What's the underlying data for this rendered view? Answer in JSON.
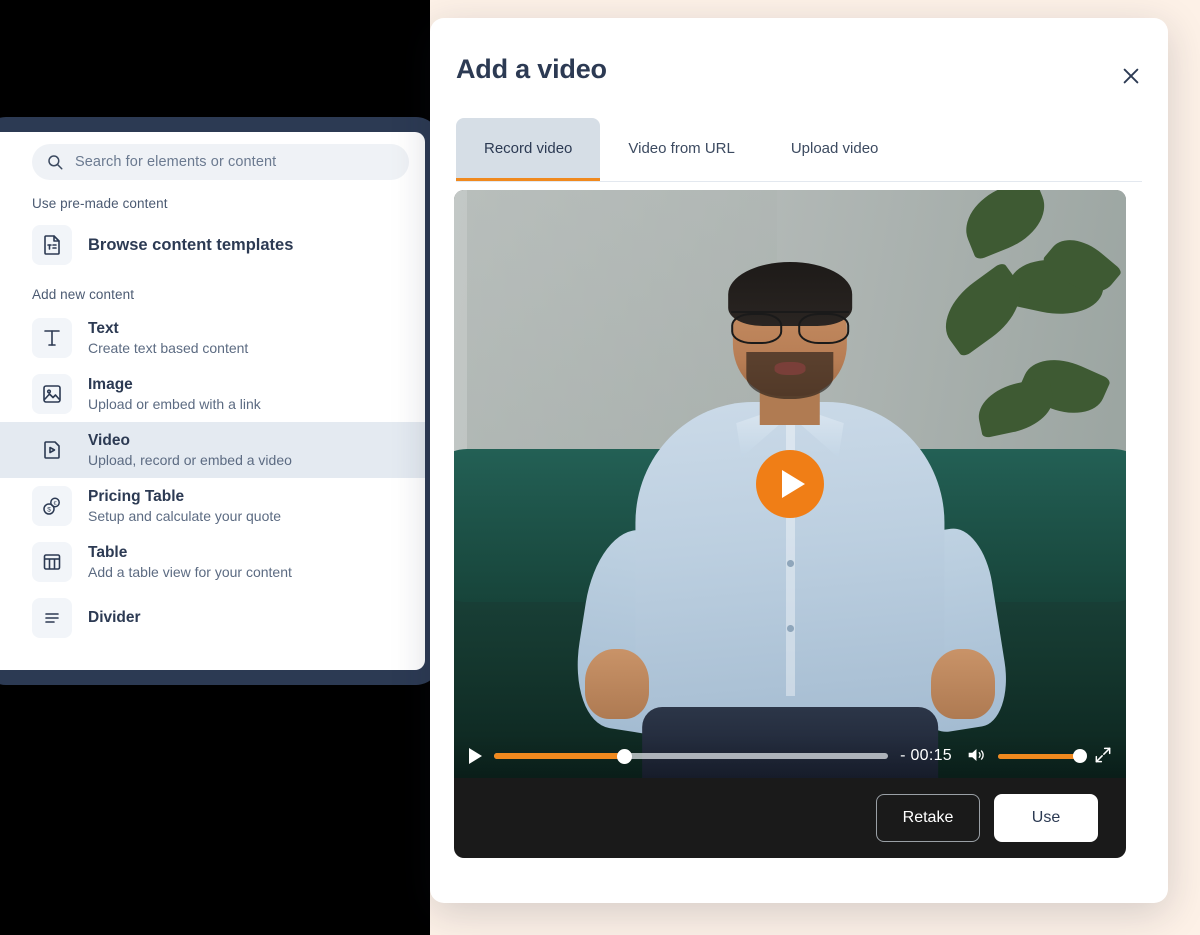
{
  "theme": {
    "page_background": "#FDF1E7",
    "accent_orange": "#F0891E",
    "navy": "#2C3A53",
    "active_tab_bg": "#D6DEE6",
    "panel_dark": "#1A1A1A"
  },
  "sidebar": {
    "search": {
      "placeholder": "Search for elements or content"
    },
    "sections": [
      {
        "label": "Use pre-made content"
      },
      {
        "label": "Add new content"
      }
    ],
    "browse": {
      "label": "Browse content templates",
      "icon": "document-text-icon"
    },
    "items": [
      {
        "title": "Text",
        "subtitle": "Create text based content",
        "icon": "text-icon",
        "active": false
      },
      {
        "title": "Image",
        "subtitle": "Upload or embed with a link",
        "icon": "image-icon",
        "active": false
      },
      {
        "title": "Video",
        "subtitle": "Upload, record or embed a video",
        "icon": "video-icon",
        "active": true
      },
      {
        "title": "Pricing Table",
        "subtitle": "Setup and calculate your quote",
        "icon": "coins-icon",
        "active": false
      },
      {
        "title": "Table",
        "subtitle": "Add a table view for your content",
        "icon": "table-icon",
        "active": false
      },
      {
        "title": "Divider",
        "subtitle": "",
        "icon": "divider-icon",
        "active": false
      }
    ]
  },
  "modal": {
    "title": "Add a video",
    "close_icon": "close-icon",
    "tabs": [
      {
        "label": "Record video",
        "active": true
      },
      {
        "label": "Video from URL",
        "active": false
      },
      {
        "label": "Upload video",
        "active": false
      }
    ],
    "player": {
      "play_overlay_icon": "play-icon",
      "play_button_icon": "play-icon",
      "time_remaining": "- 00:15",
      "progress_percent": 33,
      "volume_percent": 100,
      "volume_icon": "volume-on-icon",
      "fullscreen_icon": "fullscreen-icon"
    },
    "actions": {
      "retake_label": "Retake",
      "use_label": "Use"
    }
  }
}
